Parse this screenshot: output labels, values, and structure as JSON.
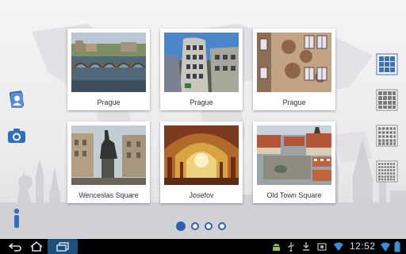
{
  "grid": {
    "cards": [
      {
        "label": "Prague",
        "photo": "bridge-river-photo"
      },
      {
        "label": "Prague",
        "photo": "dancing-house-photo"
      },
      {
        "label": "Prague",
        "photo": "painted-facade-photo"
      },
      {
        "label": "Wenceslas Square",
        "photo": "statue-square-photo"
      },
      {
        "label": "Josefov",
        "photo": "synagogue-interior-photo"
      },
      {
        "label": "Old Town Square",
        "photo": "old-town-aerial-photo"
      }
    ]
  },
  "sidebar_left": {
    "items": [
      {
        "icon": "contact-card-icon"
      },
      {
        "icon": "camera-icon"
      },
      {
        "icon": "info-icon"
      }
    ]
  },
  "view_switcher": {
    "items": [
      {
        "icon": "grid-3x3-icon",
        "selected": true
      },
      {
        "icon": "grid-4x4-icon",
        "selected": false
      },
      {
        "icon": "grid-5x5-icon",
        "selected": false
      },
      {
        "icon": "grid-6x6-icon",
        "selected": false
      }
    ]
  },
  "pager": {
    "pages": 4,
    "current": 1
  },
  "statusbar": {
    "time": "12:52",
    "accent": "#2f5fb0",
    "icons": [
      "back-icon",
      "home-icon",
      "recent-apps-icon",
      "android-icon",
      "usb-icon",
      "download-icon",
      "wifi-icon",
      "battery-icon"
    ]
  }
}
